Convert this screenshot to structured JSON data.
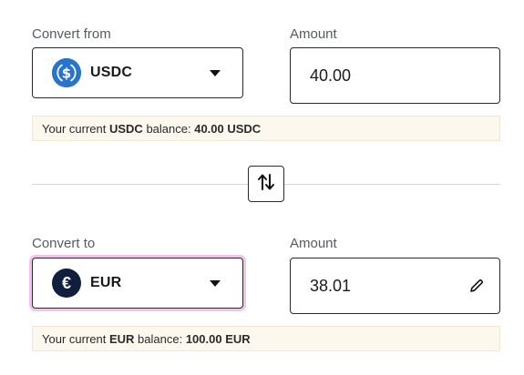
{
  "from": {
    "label": "Convert from",
    "currency": "USDC",
    "icon": "usdc-coin-icon"
  },
  "from_amount": {
    "label": "Amount",
    "value": "40.00"
  },
  "from_balance": {
    "prefix": "Your current",
    "currency": "USDC",
    "middle": "balance:",
    "amount": "40.00 USDC"
  },
  "swap": {
    "icon": "swap-arrows-icon"
  },
  "to": {
    "label": "Convert to",
    "currency": "EUR",
    "icon": "euro-coin-icon",
    "symbol": "€"
  },
  "to_amount": {
    "label": "Amount",
    "value": "38.01",
    "edit_icon": "pencil-icon"
  },
  "to_balance": {
    "prefix": "Your current",
    "currency": "EUR",
    "middle": "balance:",
    "amount": "100.00 EUR"
  },
  "colors": {
    "usdc": "#2775ca",
    "eur": "#0f1f3d",
    "focus": "#f2c3ec",
    "balance_bg": "#fdf8ee"
  }
}
